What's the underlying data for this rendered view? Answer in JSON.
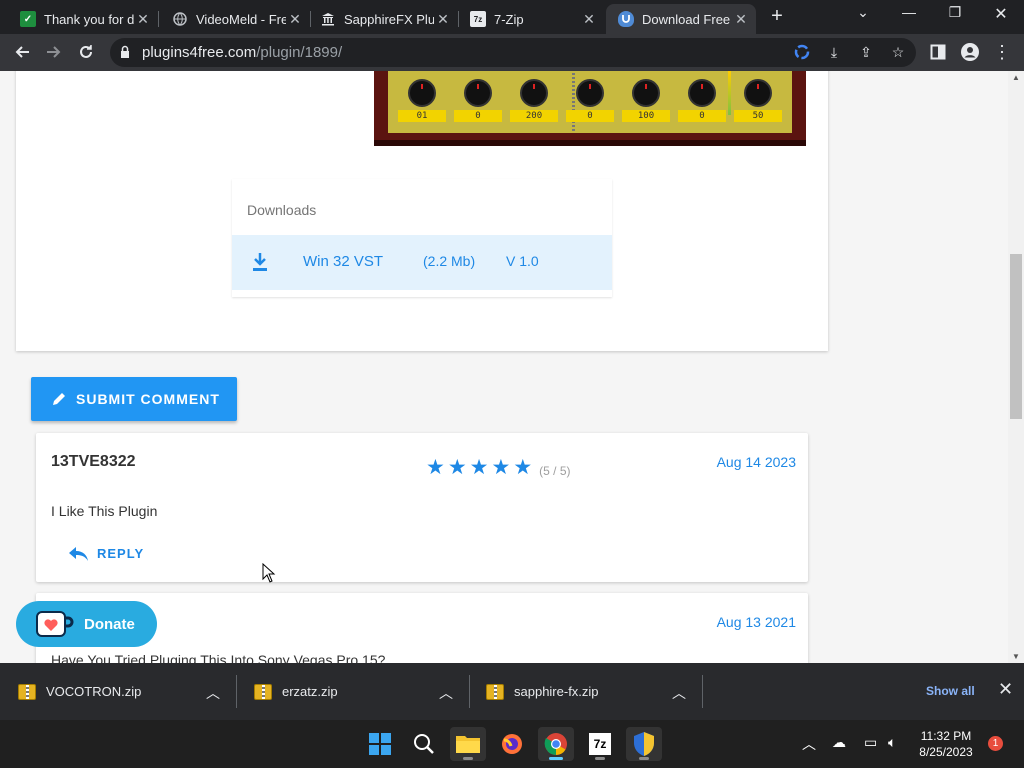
{
  "tabs": [
    {
      "title": "Thank you for d",
      "favicon": "check-sheet-icon",
      "color": "#1e8e3e"
    },
    {
      "title": "VideoMeld - Fre",
      "favicon": "globe-icon"
    },
    {
      "title": "SapphireFX Plug",
      "favicon": "museum-icon"
    },
    {
      "title": "7-Zip",
      "favicon": "7zip-icon"
    },
    {
      "title": "Download Free",
      "favicon": "shield-icon",
      "active": true
    }
  ],
  "address": {
    "host": "plugins4free.com",
    "path": "/plugin/1899/"
  },
  "plugin": {
    "values": [
      "01",
      "0",
      "200",
      "0",
      "100",
      "0",
      "50"
    ]
  },
  "downloads": {
    "heading": "Downloads",
    "item": {
      "name": "Win 32 VST",
      "size": "(2.2 Mb)",
      "version": "V 1.0"
    }
  },
  "submit_label": "SUBMIT COMMENT",
  "comments": [
    {
      "author": "13TVE8322",
      "stars": 5,
      "rating": "(5 / 5)",
      "date": "Aug 14 2023",
      "body": "I Like This Plugin",
      "reply": "REPLY"
    },
    {
      "author": "",
      "date": "Aug 13 2021",
      "body": "Have You Tried Pluging This Into Sony Vegas Pro 15?"
    }
  ],
  "donate_label": "Donate",
  "download_bar": {
    "files": [
      "VOCOTRON.zip",
      "erzatz.zip",
      "sapphire-fx.zip"
    ],
    "show_all": "Show all"
  },
  "taskbar": {
    "time": "11:32 PM",
    "date": "8/25/2023",
    "notifications": "1"
  },
  "colors": {
    "accent": "#2196f3",
    "link": "#1e88e5",
    "donate": "#29abe0"
  }
}
